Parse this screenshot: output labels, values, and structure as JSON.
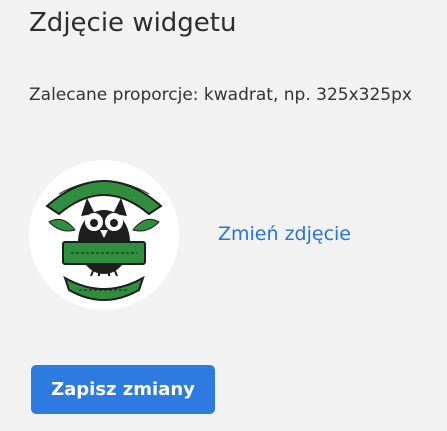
{
  "widget_photo": {
    "title": "Zdjęcie widgetu",
    "hint": "Zalecane proporcje: kwadrat, np. 325x325px",
    "change_link": "Zmień zdjęcie",
    "logo": {
      "alt_text": "Ośrodek Leczenia Puchaczówka w Wągrowcu",
      "colors": {
        "green": "#2f8f3f",
        "dark": "#1e1e1e",
        "white": "#ffffff"
      }
    }
  },
  "actions": {
    "save_label": "Zapisz zmiany",
    "accent": "#2d7ae0"
  }
}
